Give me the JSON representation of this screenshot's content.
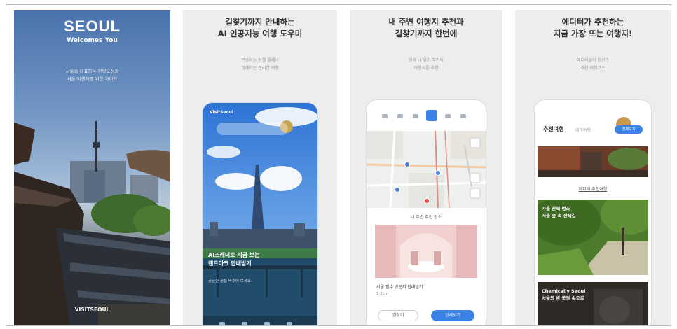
{
  "panel1": {
    "title": "SEOUL",
    "subtitle": "Welcomes You",
    "desc_line1": "서울을 대표하는 한양도성과",
    "desc_line2": "서울 여행자를 위한 가이드",
    "brand": "VISITSEOUL"
  },
  "panel2": {
    "caption_line1": "길찾기까지 안내하는",
    "caption_line2": "AI 인공지능 여행 도우미",
    "sub_line1": "인공지능 여행 플래너",
    "sub_line2": "함께하는 편리한 여행",
    "app_label": "VisitSeoul",
    "overlay_line1": "AI스캐너로 지금 보는",
    "overlay_line2": "랜드마크 안내받기",
    "overlay_small": "궁금한 곳을 비추어 보세요"
  },
  "panel3": {
    "caption_line1": "내 주변 여행지 추천과",
    "caption_line2": "길찾기까지 한번에",
    "sub_line1": "현재 내 위치 주변의",
    "sub_line2": "여행지를 추천",
    "section_label": "내 주변 추천 장소",
    "card_title": "서울 필수 방문지 안내받기",
    "card_meta": "1.2km",
    "button_left": "길찾기",
    "button_right": "상세보기"
  },
  "panel4": {
    "caption_line1": "에디터가 추천하는",
    "caption_line2": "지금 가장 뜨는 여행지!",
    "sub_line1": "에디터들이 엄선한",
    "sub_line2": "추천 여행코스",
    "header": "추천여행",
    "header_tab": "테마여행",
    "header_button": "전체보기",
    "section_label": "에디터 추천여행",
    "card1_line1": "가을 산책 명소",
    "card1_line2": "서울 숲 속 산책길",
    "card2_line1": "Chemically Seoul",
    "card2_line2": "서울의 밤 풍경 속으로"
  },
  "colors": {
    "accent_blue": "#3c82e6",
    "panel_bg": "#ededed",
    "caption": "#333333"
  }
}
